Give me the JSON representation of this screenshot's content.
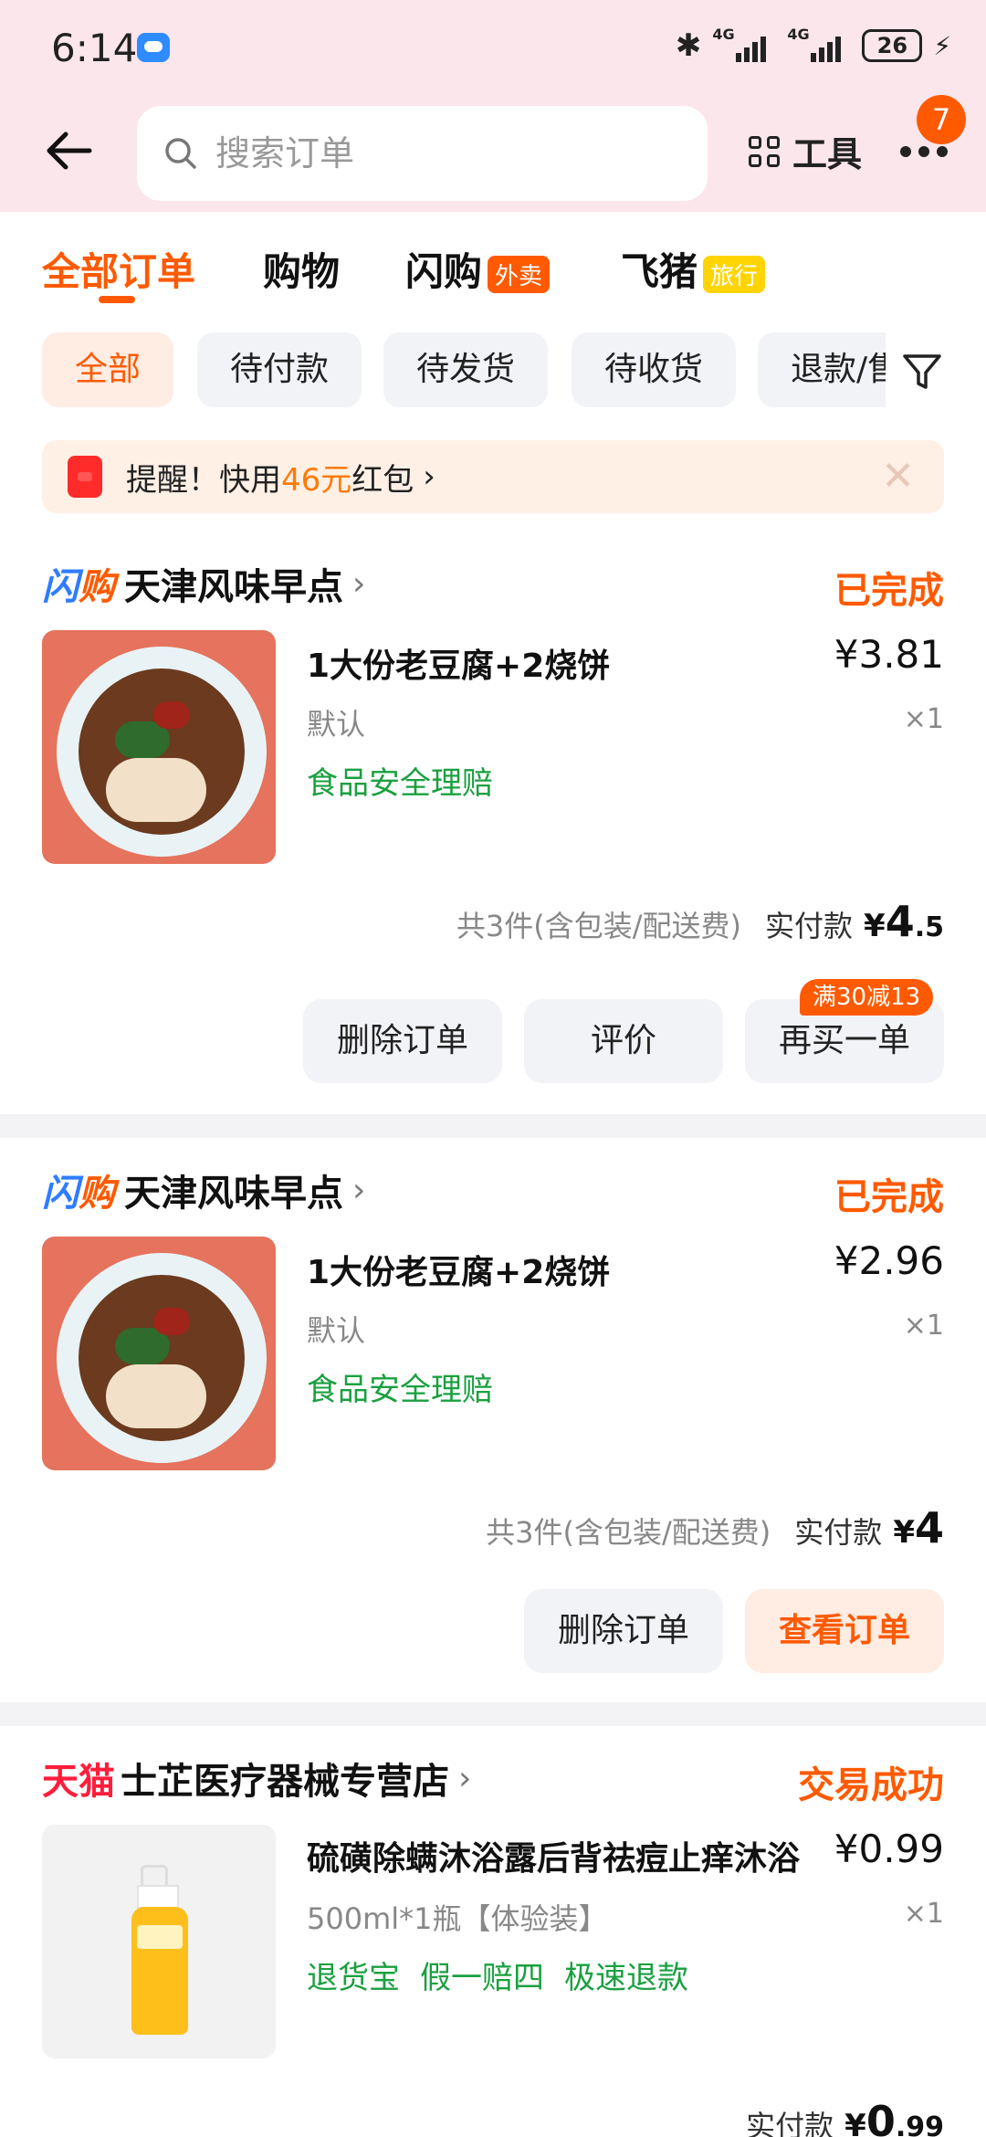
{
  "status_bar": {
    "time": "6:14",
    "network1": "4G",
    "network2": "4G",
    "battery": "26"
  },
  "header": {
    "search_placeholder": "搜索订单",
    "tools_label": "工具",
    "more_badge": "7"
  },
  "tabs": [
    {
      "label": "全部订单",
      "tag": ""
    },
    {
      "label": "购物",
      "tag": ""
    },
    {
      "label": "闪购",
      "tag": "外卖"
    },
    {
      "label": "飞猪",
      "tag": "旅行"
    }
  ],
  "filters": [
    "全部",
    "待付款",
    "待发货",
    "待收货",
    "退款/售后"
  ],
  "reminder": {
    "prefix": "提醒！快用",
    "amount": "46元",
    "suffix": "红包"
  },
  "orders": [
    {
      "brand_a": "闪",
      "brand_b": "购",
      "shop": "天津风味早点",
      "status": "已完成",
      "title": "1大份老豆腐+2烧饼",
      "price": "¥3.81",
      "spec": "默认",
      "qty": "×1",
      "services": [
        "食品安全理赔"
      ],
      "count_text": "共3件(含包装/配送费)",
      "pay_label": "实付款",
      "pay_yen": "¥",
      "pay_int": "4",
      "pay_dec": ".5",
      "buttons": [
        "删除订单",
        "评价",
        "再买一单"
      ],
      "promo": "满30减13"
    },
    {
      "brand_a": "闪",
      "brand_b": "购",
      "shop": "天津风味早点",
      "status": "已完成",
      "title": "1大份老豆腐+2烧饼",
      "price": "¥2.96",
      "spec": "默认",
      "qty": "×1",
      "services": [
        "食品安全理赔"
      ],
      "count_text": "共3件(含包装/配送费)",
      "pay_label": "实付款",
      "pay_yen": "¥",
      "pay_int": "4",
      "pay_dec": "",
      "buttons": [
        "删除订单",
        "查看订单"
      ]
    },
    {
      "brand": "天猫",
      "shop": "士芷医疗器械专营店",
      "status": "交易成功",
      "title": "硫磺除螨沐浴露后背祛痘止痒沐浴",
      "price": "¥0.99",
      "spec": "500ml*1瓶【体验装】",
      "qty": "×1",
      "services": [
        "退货宝",
        "假一赔四",
        "极速退款"
      ],
      "pay_label": "实付款",
      "pay_yen": "¥",
      "pay_int": "0",
      "pay_dec": ".99"
    }
  ],
  "colors": {
    "accent": "#ff5a00",
    "header_bg": "#fbe6ec",
    "service_green": "#1aa040",
    "tmall_red": "#ff1d3c"
  }
}
